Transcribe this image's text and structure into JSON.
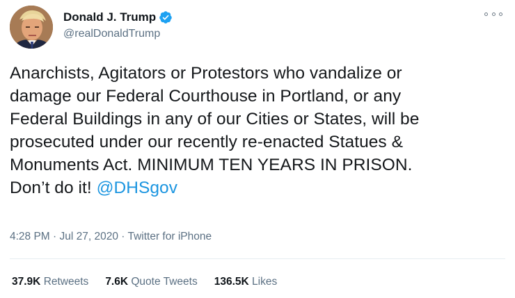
{
  "author": {
    "display_name": "Donald J. Trump",
    "handle": "@realDonaldTrump",
    "verified": true
  },
  "tweet": {
    "lines": [
      "Anarchists, Agitators or Protestors who vandalize or",
      "damage our Federal Courthouse in Portland, or any",
      "Federal Buildings in any of our Cities or States, will be",
      "prosecuted under our recently re-enacted Statues &",
      "Monuments Act. MINIMUM TEN YEARS IN PRISON."
    ],
    "last_line_prefix": "Don’t do it! ",
    "mention": "@DHSgov"
  },
  "meta": {
    "time": "4:28 PM",
    "separator": " · ",
    "date": "Jul 27, 2020",
    "source": "Twitter for iPhone"
  },
  "stats": [
    {
      "count": "37.9K",
      "label": "Retweets"
    },
    {
      "count": "7.6K",
      "label": "Quote Tweets"
    },
    {
      "count": "136.5K",
      "label": "Likes"
    }
  ],
  "colors": {
    "link": "#1b95e0",
    "secondary_text": "#5b7083",
    "verified_badge": "#1da1f2",
    "divider": "#e6ecf0"
  },
  "icons": {
    "verified": "verified-badge-icon",
    "more": "more-options-icon"
  }
}
